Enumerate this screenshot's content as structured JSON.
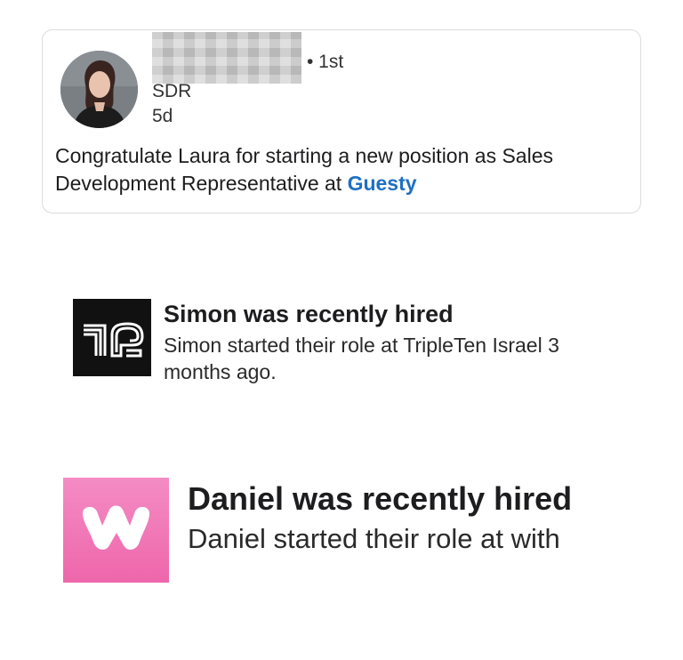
{
  "post": {
    "degree": "• 1st",
    "role": "SDR",
    "time": "5d",
    "text_prefix": "Congratulate Laura for starting a new position as Sales Development Representative at ",
    "company_link": "Guesty"
  },
  "hire1": {
    "title": "Simon was recently hired",
    "description": "Simon started their role at TripleTen Israel 3 months ago.",
    "logo": "tripleten-logo-icon"
  },
  "hire2": {
    "title": "Daniel was recently hired",
    "description": "Daniel started their role at with",
    "logo": "w-logo-icon"
  },
  "colors": {
    "link": "#1e6fc4",
    "tt_logo_bg": "#111111",
    "w_logo_bg": "#ee66ab"
  }
}
